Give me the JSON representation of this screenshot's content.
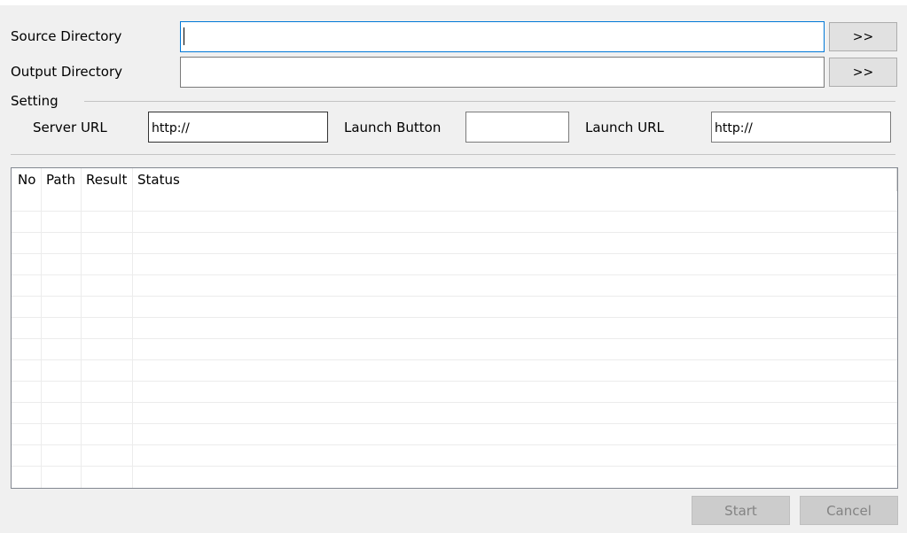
{
  "source": {
    "label": "Source Directory",
    "value": "",
    "browse_label": ">>"
  },
  "output": {
    "label": "Output Directory",
    "value": "",
    "browse_label": ">>"
  },
  "setting": {
    "group_label": "Setting",
    "server_url_label": "Server URL",
    "server_url_value": "http://",
    "launch_button_label": "Launch Button",
    "launch_button_value": "",
    "launch_url_label": "Launch URL",
    "launch_url_value": "http://"
  },
  "table": {
    "columns": [
      "No",
      "Path",
      "Result",
      "Status"
    ],
    "rows": []
  },
  "actions": {
    "start_label": "Start",
    "cancel_label": "Cancel"
  }
}
